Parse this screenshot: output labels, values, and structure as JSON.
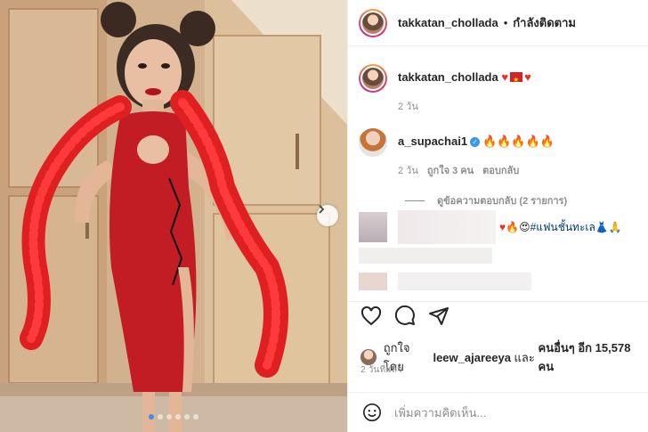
{
  "post": {
    "username": "takkatan_chollada",
    "separator": "•",
    "follow_status": "กำลังติดตาม",
    "image_alt": "Woman in red qipao with red feather boa",
    "carousel": {
      "dot_count": 6,
      "active_index": 0
    }
  },
  "caption": {
    "username": "takkatan_chollada",
    "emoji_text": "♥ ♥",
    "time": "2 วัน"
  },
  "comment": {
    "username": "a_supachai1",
    "verified_mark": "✓",
    "emoji_text": "🔥🔥🔥🔥🔥",
    "time": "2 วัน",
    "likes": "ถูกใจ 3 คน",
    "reply": "ตอบกลับ"
  },
  "view_replies": "ดูข้อความตอบกลับ (2 รายการ)",
  "blurred_comment": {
    "visible_text": "#แฟนชั้นทะเล"
  },
  "liked_by": {
    "prefix": "ถูกใจโดย",
    "user": "leew_ajareeya",
    "joiner": "และ",
    "others": "คนอื่นๆ อีก 15,578 คน"
  },
  "posted_ago": "2 วันที่แล้ว",
  "add_comment": {
    "placeholder": "เพิ่มความคิดเห็น..."
  },
  "colors": {
    "accent_blue": "#3897f0",
    "text_primary": "#262626",
    "text_secondary": "#8e8e8e",
    "dress_red": "#c21c25",
    "boa_red": "#e02020"
  }
}
